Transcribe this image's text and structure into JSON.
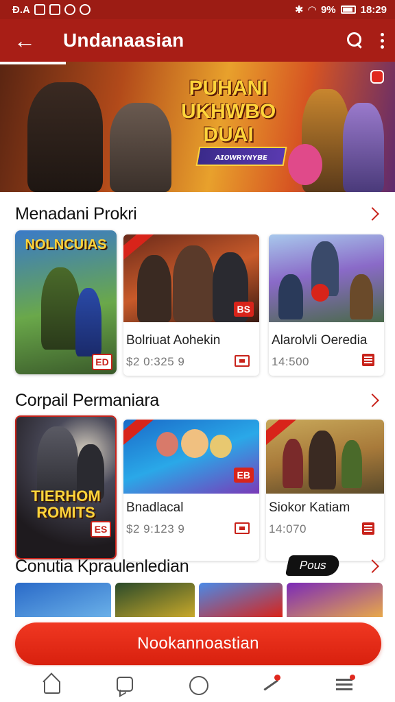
{
  "status_bar": {
    "left_text": "Đ.A",
    "time": "18:29",
    "battery": "9%"
  },
  "app_bar": {
    "back_glyph": "←",
    "title": "Undanaasian"
  },
  "banner": {
    "title": "PUHANI UKHWBO DUAI",
    "tag": "ᴀɪᴏᴡʀʏɴʏʙᴇ"
  },
  "sections": [
    {
      "title": "Menadani Prokri",
      "featured": {
        "title": "NOLNCUIAS",
        "badge": "ED"
      },
      "cards": [
        {
          "chip": "BS",
          "name": "Bolriuat Aohekin",
          "price": "$2 0:325 9"
        },
        {
          "chip": "",
          "name": "Alarolvli Oeredia",
          "price": "14:500"
        }
      ]
    },
    {
      "title": "Corpail Permaniara",
      "featured": {
        "title": "TIERHOM ROMITS",
        "badge": "ES"
      },
      "cards": [
        {
          "chip": "EB",
          "name": "Bnadlacal",
          "price": "$2 9:123 9"
        },
        {
          "chip": "",
          "name": "Siokor Katiam",
          "price": "14:070"
        }
      ]
    },
    {
      "title": "Conutia Kpraulenledian",
      "pill": "Pous"
    }
  ],
  "cta": {
    "label": "Nookannoastian"
  },
  "colors": {
    "primary": "#a81e16",
    "accent": "#d8241a",
    "cta": "#ea2c18"
  },
  "nav_icons": [
    "home-icon",
    "chat-icon",
    "hexagon-icon",
    "stats-icon",
    "menu-icon"
  ]
}
